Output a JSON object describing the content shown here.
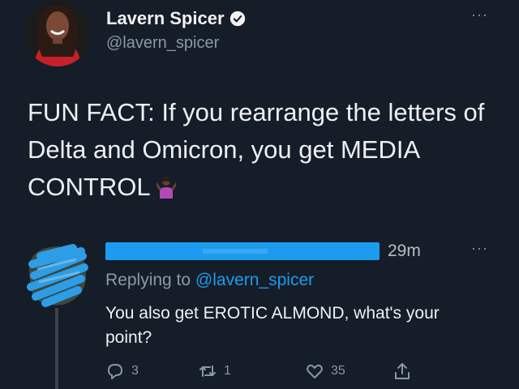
{
  "tweet": {
    "author": {
      "name": "Lavern Spicer",
      "handle": "@lavern_spicer",
      "verified": true
    },
    "more_glyph": "···",
    "text": "FUN FACT: If you rearrange the letters of Delta and Omicron, you get MEDIA CONTROL"
  },
  "reply": {
    "time": "29m",
    "more_glyph": "···",
    "replying_prefix": "Replying to ",
    "replying_handle": "@lavern_spicer",
    "text": "You also get EROTIC ALMOND, what's your point?",
    "counts": {
      "replies": "3",
      "retweets": "1",
      "likes": "35"
    }
  },
  "colors": {
    "background": "#151d28",
    "accent": "#1d9bf0",
    "muted": "#8b98a5"
  },
  "icons": [
    "verified-badge-icon",
    "shrug-emoji-icon",
    "reply-icon",
    "retweet-icon",
    "like-icon",
    "share-icon"
  ]
}
